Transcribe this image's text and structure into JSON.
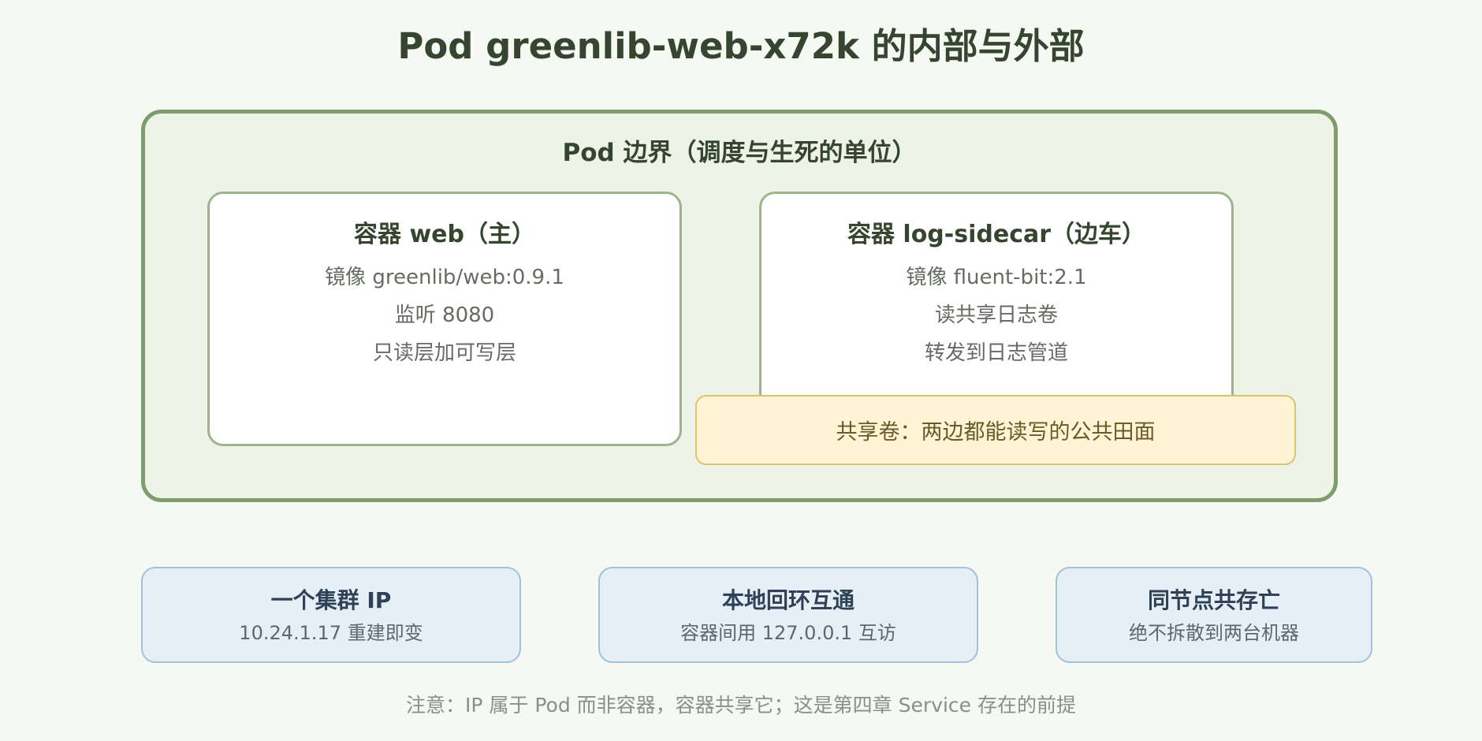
{
  "title": "Pod greenlib-web-x72k 的内部与外部",
  "pod": {
    "label": "Pod 边界（调度与生死的单位）",
    "containers": [
      {
        "title": "容器 web（主）",
        "lines": [
          "镜像 greenlib/web:0.9.1",
          "监听 8080",
          "只读层加可写层"
        ]
      },
      {
        "title": "容器 log-sidecar（边车）",
        "lines": [
          "镜像 fluent-bit:2.1",
          "读共享日志卷",
          "转发到日志管道"
        ]
      }
    ],
    "shared_volume": "共享卷：两边都能读写的公共田面"
  },
  "facts": [
    {
      "title": "一个集群 IP",
      "sub": "10.24.1.17 重建即变"
    },
    {
      "title": "本地回环互通",
      "sub": "容器间用 127.0.0.1 互访"
    },
    {
      "title": "同节点共存亡",
      "sub": "绝不拆散到两台机器"
    }
  ],
  "note": "注意：IP 属于 Pod 而非容器，容器共享它；这是第四章 Service 存在的前提"
}
